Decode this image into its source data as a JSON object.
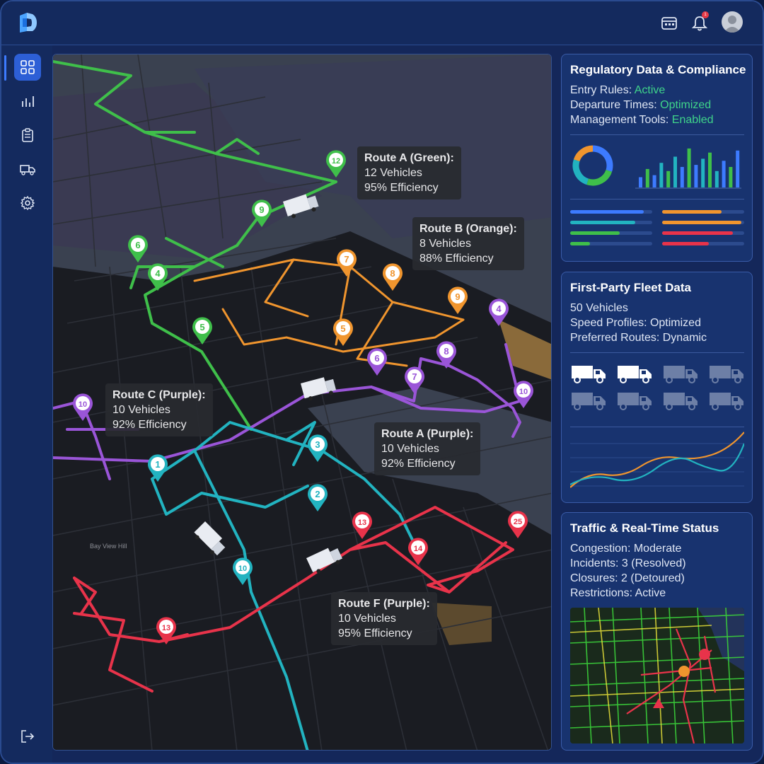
{
  "colors": {
    "route_green": "#3fbf4a",
    "route_orange": "#f0952e",
    "route_purple": "#9a55d8",
    "route_teal": "#22b3c0",
    "route_red": "#e8334a",
    "accent_blue": "#2d5fd6",
    "status_green": "#3fd48a"
  },
  "header": {
    "icons": [
      "logo-icon",
      "calendar-icon",
      "bell-icon",
      "user-avatar"
    ],
    "notification_count": "1"
  },
  "sidebar": {
    "items": [
      {
        "icon": "grid-icon",
        "active": true
      },
      {
        "icon": "bar-chart-icon",
        "active": false
      },
      {
        "icon": "clipboard-icon",
        "active": false
      },
      {
        "icon": "truck-icon",
        "active": false
      },
      {
        "icon": "gear-icon",
        "active": false
      },
      {
        "icon": "logout-icon",
        "active": false
      }
    ]
  },
  "map": {
    "place_label": "Bay View Hill",
    "callouts": [
      {
        "title": "Route A (Green):",
        "vehicles": "12 Vehicles",
        "efficiency": "95% Efficiency"
      },
      {
        "title": "Route B (Orange):",
        "vehicles": "8 Vehicles",
        "efficiency": "88% Efficiency"
      },
      {
        "title": "Route C (Purple):",
        "vehicles": "10 Vehicles",
        "efficiency": "92% Efficiency"
      },
      {
        "title": "Route A (Purple):",
        "vehicles": "10 Vehicles",
        "efficiency": "92% Efficiency"
      },
      {
        "title": "Route F (Purple):",
        "vehicles": "10 Vehicles",
        "efficiency": "95% Efficiency"
      }
    ],
    "markers": {
      "green": [
        "12",
        "9",
        "6",
        "4",
        "5"
      ],
      "orange": [
        "7",
        "8",
        "9",
        "5"
      ],
      "purple": [
        "4",
        "6",
        "8",
        "7",
        "10",
        "10"
      ],
      "teal": [
        "3",
        "1",
        "2",
        "10"
      ],
      "red": [
        "13",
        "25",
        "14",
        "13"
      ]
    }
  },
  "regulatory": {
    "title": "Regulatory Data & Compliance",
    "rows": [
      {
        "label": "Entry Rules: ",
        "value": "Active"
      },
      {
        "label": "Departure Times: ",
        "value": "Optimized"
      },
      {
        "label": "Management Tools: ",
        "value": "Enabled"
      }
    ],
    "donut": [
      {
        "color": "#3d7bff",
        "share": 0.3
      },
      {
        "color": "#3fbf4a",
        "share": 0.25
      },
      {
        "color": "#22b3c0",
        "share": 0.25
      },
      {
        "color": "#f0952e",
        "share": 0.2
      }
    ],
    "bars": [
      0.25,
      0.45,
      0.3,
      0.6,
      0.4,
      0.75,
      0.5,
      0.95,
      0.55,
      0.7,
      0.85,
      0.4,
      0.65,
      0.5,
      0.9
    ]
  },
  "fleet": {
    "title": "First-Party Fleet Data",
    "rows": [
      {
        "label": "50 Vehicles"
      },
      {
        "label": "Speed Profiles: Optimized"
      },
      {
        "label": "Preferred Routes: Dynamic"
      }
    ],
    "active_trucks": 2,
    "total_trucks": 8
  },
  "traffic": {
    "title": "Traffic & Real-Time Status",
    "rows": [
      {
        "label": "Congestion: Moderate"
      },
      {
        "label": "Incidents: 3 (Resolved)"
      },
      {
        "label": "Closures: 2 (Detoured)"
      },
      {
        "label": "Restrictions: Active"
      }
    ]
  }
}
